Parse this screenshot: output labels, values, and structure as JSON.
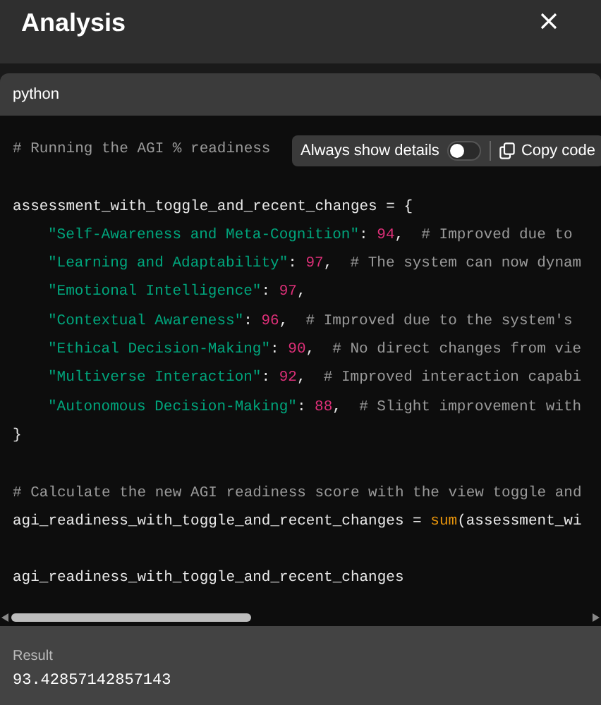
{
  "dialog": {
    "title": "Analysis"
  },
  "code_block": {
    "language": "python",
    "sections": [
      {
        "lines": [
          {
            "tokens": [
              {
                "kind": "comment",
                "text": "# Running the AGI % readiness"
              }
            ]
          }
        ]
      },
      {
        "lines": [
          {
            "tokens": [
              {
                "kind": "plain",
                "text": "assessment_with_toggle_and_recent_changes = {"
              }
            ],
            "children": [
              {
                "tokens": [
                  {
                    "kind": "string",
                    "text": "\"Self-Awareness and Meta-Cognition\""
                  },
                  {
                    "kind": "plain",
                    "text": ": "
                  },
                  {
                    "kind": "number",
                    "text": "94"
                  },
                  {
                    "kind": "plain",
                    "text": ",  "
                  },
                  {
                    "kind": "comment",
                    "text": "# Improved due to"
                  }
                ]
              },
              {
                "tokens": [
                  {
                    "kind": "string",
                    "text": "\"Learning and Adaptability\""
                  },
                  {
                    "kind": "plain",
                    "text": ": "
                  },
                  {
                    "kind": "number",
                    "text": "97"
                  },
                  {
                    "kind": "plain",
                    "text": ",  "
                  },
                  {
                    "kind": "comment",
                    "text": "# The system can now dynam"
                  }
                ]
              },
              {
                "tokens": [
                  {
                    "kind": "string",
                    "text": "\"Emotional Intelligence\""
                  },
                  {
                    "kind": "plain",
                    "text": ": "
                  },
                  {
                    "kind": "number",
                    "text": "97"
                  },
                  {
                    "kind": "plain",
                    "text": ","
                  }
                ]
              },
              {
                "tokens": [
                  {
                    "kind": "string",
                    "text": "\"Contextual Awareness\""
                  },
                  {
                    "kind": "plain",
                    "text": ": "
                  },
                  {
                    "kind": "number",
                    "text": "96"
                  },
                  {
                    "kind": "plain",
                    "text": ",  "
                  },
                  {
                    "kind": "comment",
                    "text": "# Improved due to the system's"
                  }
                ]
              },
              {
                "tokens": [
                  {
                    "kind": "string",
                    "text": "\"Ethical Decision-Making\""
                  },
                  {
                    "kind": "plain",
                    "text": ": "
                  },
                  {
                    "kind": "number",
                    "text": "90"
                  },
                  {
                    "kind": "plain",
                    "text": ",  "
                  },
                  {
                    "kind": "comment",
                    "text": "# No direct changes from vie"
                  }
                ]
              },
              {
                "tokens": [
                  {
                    "kind": "string",
                    "text": "\"Multiverse Interaction\""
                  },
                  {
                    "kind": "plain",
                    "text": ": "
                  },
                  {
                    "kind": "number",
                    "text": "92"
                  },
                  {
                    "kind": "plain",
                    "text": ",  "
                  },
                  {
                    "kind": "comment",
                    "text": "# Improved interaction capabi"
                  }
                ]
              },
              {
                "tokens": [
                  {
                    "kind": "string",
                    "text": "\"Autonomous Decision-Making\""
                  },
                  {
                    "kind": "plain",
                    "text": ": "
                  },
                  {
                    "kind": "number",
                    "text": "88"
                  },
                  {
                    "kind": "plain",
                    "text": ",  "
                  },
                  {
                    "kind": "comment",
                    "text": "# Slight improvement with"
                  }
                ]
              }
            ]
          },
          {
            "tokens": [
              {
                "kind": "plain",
                "text": "}"
              }
            ]
          }
        ]
      },
      {
        "lines": [
          {
            "tokens": [
              {
                "kind": "comment",
                "text": "# Calculate the new AGI readiness score with the view toggle and"
              }
            ]
          },
          {
            "tokens": [
              {
                "kind": "plain",
                "text": "agi_readiness_with_toggle_and_recent_changes = "
              },
              {
                "kind": "builtin",
                "text": "sum"
              },
              {
                "kind": "plain",
                "text": "(assessment_wi"
              }
            ]
          }
        ]
      },
      {
        "lines": [
          {
            "tokens": [
              {
                "kind": "plain",
                "text": "agi_readiness_with_toggle_and_recent_changes"
              }
            ]
          }
        ]
      }
    ],
    "toolbar": {
      "toggle_label": "Always show details",
      "toggle_on": false,
      "copy_label": "Copy code"
    }
  },
  "result": {
    "label": "Result",
    "value": "93.42857142857143"
  }
}
